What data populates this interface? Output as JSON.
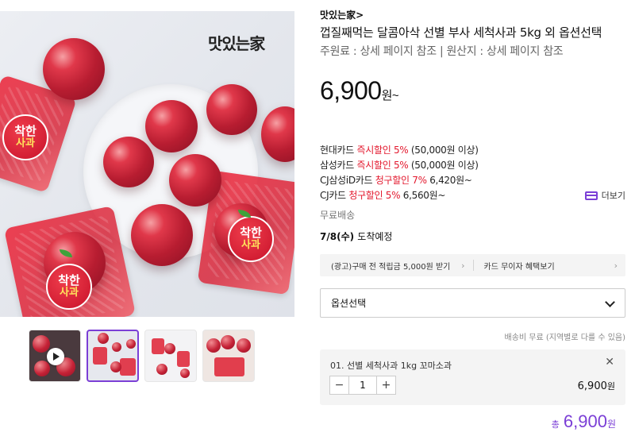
{
  "gallery": {
    "logo_text": "맛있는家",
    "badge_line1": "착한",
    "badge_line2": "사과",
    "thumbnails": [
      {
        "kind": "video"
      },
      {
        "kind": "image",
        "selected": true
      },
      {
        "kind": "image"
      },
      {
        "kind": "image"
      }
    ]
  },
  "product": {
    "brand": "맛있는家",
    "brand_chevron": ">",
    "title": "껍질째먹는 달콤아삭 선별 부사 세척사과 5kg 외 옵션선택",
    "meta": "주원료 : 상세 페이지 참조 | 원산지 : 상세 페이지 참조",
    "price": "6,900",
    "price_unit": "원~"
  },
  "card_offers": [
    {
      "card": "현대카드",
      "benefit": "즉시할인 5%",
      "detail": "(50,000원 이상)"
    },
    {
      "card": "삼성카드",
      "benefit": "즉시할인 5%",
      "detail": "(50,000원 이상)"
    },
    {
      "card": "CJ삼성iD카드",
      "benefit": "청구할인 7%",
      "detail": "6,420원~"
    },
    {
      "card": "CJ카드",
      "benefit": "청구할인 5%",
      "detail": "6,560원~"
    }
  ],
  "more_label": "더보기",
  "shipping": "무료배송",
  "arrival": {
    "date": "7/8(수)",
    "label": "도착예정"
  },
  "promos": [
    {
      "label": "(광고)구매 전 적립금 5,000원 받기"
    },
    {
      "label": "카드 무이자 혜택보기"
    }
  ],
  "option_select": {
    "label": "옵션선택"
  },
  "delivery_note": "배송비 무료 (지역별로 다를 수 있음)",
  "selected_option": {
    "name": "01. 선별 세척사과 1kg 꼬마소과",
    "quantity": "1",
    "minus": "−",
    "plus": "+",
    "price": "6,900",
    "price_unit": "원",
    "remove": "✕"
  },
  "total": {
    "label": "총",
    "amount": "6,900",
    "unit": "원"
  },
  "colors": {
    "accent": "#7b3fd6",
    "discount": "#e3192e"
  }
}
